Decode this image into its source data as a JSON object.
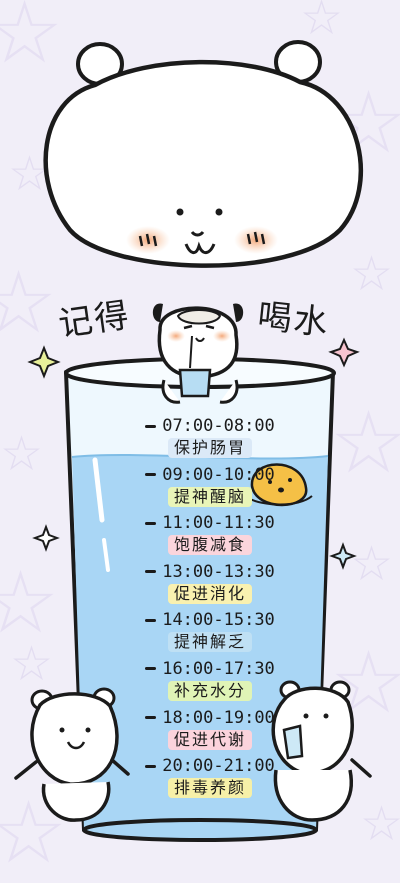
{
  "title": {
    "left": "记得",
    "right": "喝水"
  },
  "schedule": [
    {
      "time": "07:00-08:00",
      "benefit": "保护肠胃",
      "highlight": "#dbe9f7"
    },
    {
      "time": "09:00-10:00",
      "benefit": "提神醒脑",
      "highlight": "#e9f5b8"
    },
    {
      "time": "11:00-11:30",
      "benefit": "饱腹减食",
      "highlight": "#fbd5dc"
    },
    {
      "time": "13:00-13:30",
      "benefit": "促进消化",
      "highlight": "#f9f1b0"
    },
    {
      "time": "14:00-15:30",
      "benefit": "提神解乏",
      "highlight": "#bfe0f4"
    },
    {
      "time": "16:00-17:30",
      "benefit": "补充水分",
      "highlight": "#e0f4b6"
    },
    {
      "time": "18:00-19:00",
      "benefit": "促进代谢",
      "highlight": "#fbd3dc"
    },
    {
      "time": "20:00-21:00",
      "benefit": "排毒养颜",
      "highlight": "#f6f0a8"
    }
  ],
  "colors": {
    "background": "#f1eef8",
    "water": "#a9d6f5",
    "glass": "#eef8fe",
    "blush": "#f4b58a",
    "ink": "#1b1b1b"
  },
  "icons": [
    "bear-face-icon",
    "pug-icon",
    "blob-icon",
    "bear-left-icon",
    "bear-right-icon",
    "sparkle-icon",
    "star-pattern-icon"
  ]
}
